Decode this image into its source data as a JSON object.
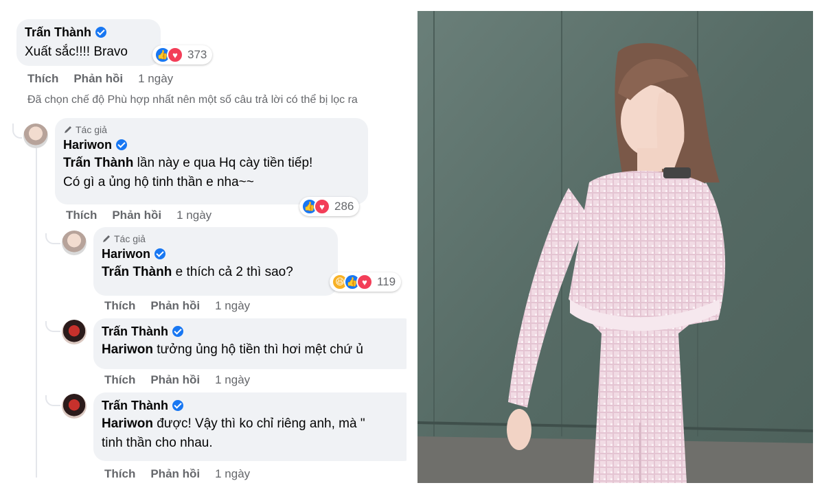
{
  "top_comment": {
    "author": "Trấn Thành",
    "text": "Xuất sắc!!!! Bravo",
    "reaction_count": "373",
    "actions": {
      "like": "Thích",
      "reply": "Phản hồi",
      "time": "1 ngày"
    }
  },
  "filter_notice": "Đã chọn chế độ Phù hợp nhất nên một số câu trả lời có thể bị lọc ra",
  "replies": [
    {
      "badge": "Tác giả",
      "author": "Hariwon",
      "mention": "Trấn Thành",
      "text_line1": " lần này e qua Hq cày tiền tiếp!",
      "text_line2": "Có gì a ủng hộ tinh thần e nha~~",
      "reaction_count": "286",
      "actions": {
        "like": "Thích",
        "reply": "Phản hồi",
        "time": "1 ngày"
      }
    },
    {
      "badge": "Tác giả",
      "author": "Hariwon",
      "mention": "Trấn Thành",
      "text_line1": " e thích cả 2 thì sao?",
      "reaction_count": "119",
      "actions": {
        "like": "Thích",
        "reply": "Phản hồi",
        "time": "1 ngày"
      }
    },
    {
      "author": "Trấn Thành",
      "mention": "Hariwon",
      "text_line1": " tưởng ủng hộ tiền thì hơi mệt chứ ủ",
      "actions": {
        "like": "Thích",
        "reply": "Phản hồi",
        "time": "1 ngày"
      }
    },
    {
      "author": "Trấn Thành",
      "mention": "Hariwon",
      "text_line1": " được! Vậy thì ko chỉ riêng anh, mà \"",
      "text_line2": "tinh thần cho nhau.",
      "actions": {
        "like": "Thích",
        "reply": "Phản hồi",
        "time": "1 ngày"
      }
    }
  ],
  "colors": {
    "accent": "#1877f2",
    "bubble": "#f0f2f5",
    "muted": "#65676b",
    "wall": "#5b706a"
  },
  "photo": {
    "icon": "woman-in-pink-tweed-dress-photo"
  }
}
